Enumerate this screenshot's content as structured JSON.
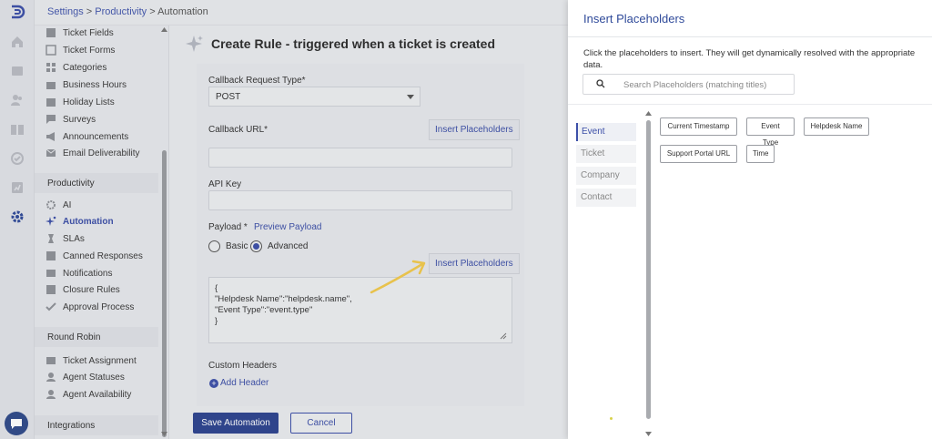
{
  "breadcrumb": {
    "settings": "Settings",
    "sep1": " > ",
    "productivity": "Productivity",
    "sep2": " > ",
    "current": "Automation"
  },
  "sidebar": {
    "items_top": [
      "Ticket Fields",
      "Ticket Forms",
      "Categories",
      "Business Hours",
      "Holiday Lists",
      "Surveys",
      "Announcements",
      "Email Deliverability"
    ],
    "section_productivity": "Productivity",
    "items_productivity": [
      "AI",
      "Automation",
      "SLAs",
      "Canned Responses",
      "Notifications",
      "Closure Rules",
      "Approval Process"
    ],
    "section_round_robin": "Round Robin",
    "items_round_robin": [
      "Ticket Assignment",
      "Agent Statuses",
      "Agent Availability"
    ],
    "section_integrations": "Integrations"
  },
  "main": {
    "title": "Create Rule - triggered when a ticket is created",
    "callback_type_label": "Callback Request Type*",
    "callback_type_value": "POST",
    "callback_url_label": "Callback URL*",
    "insert_placeholders": "Insert Placeholders",
    "api_key_label": "API Key",
    "payload_label": "Payload *",
    "preview_payload": "Preview Payload",
    "radio_basic": "Basic",
    "radio_advanced": "Advanced",
    "payload_text": "{\n\"Helpdesk Name\":\"helpdesk.name\",\n\"Event Type\":\"event.type\"\n}",
    "custom_headers_label": "Custom Headers",
    "add_header": "Add Header",
    "save_button": "Save Automation",
    "cancel_button": "Cancel"
  },
  "drawer": {
    "title": "Insert Placeholders",
    "description": "Click the placeholders to insert. They will get dynamically resolved with the appropriate data.",
    "search_placeholder": "Search Placeholders (matching titles)",
    "categories": [
      "Event",
      "Ticket",
      "Company",
      "Contact"
    ],
    "active_category": "Event",
    "chips": [
      "Current Timestamp",
      "Event Type",
      "Helpdesk Name",
      "Support Portal URL",
      "Time"
    ]
  },
  "colors": {
    "accent": "#3c4fa8",
    "primary_button": "#2d438f",
    "annotation_arrow": "#f2c94c"
  }
}
